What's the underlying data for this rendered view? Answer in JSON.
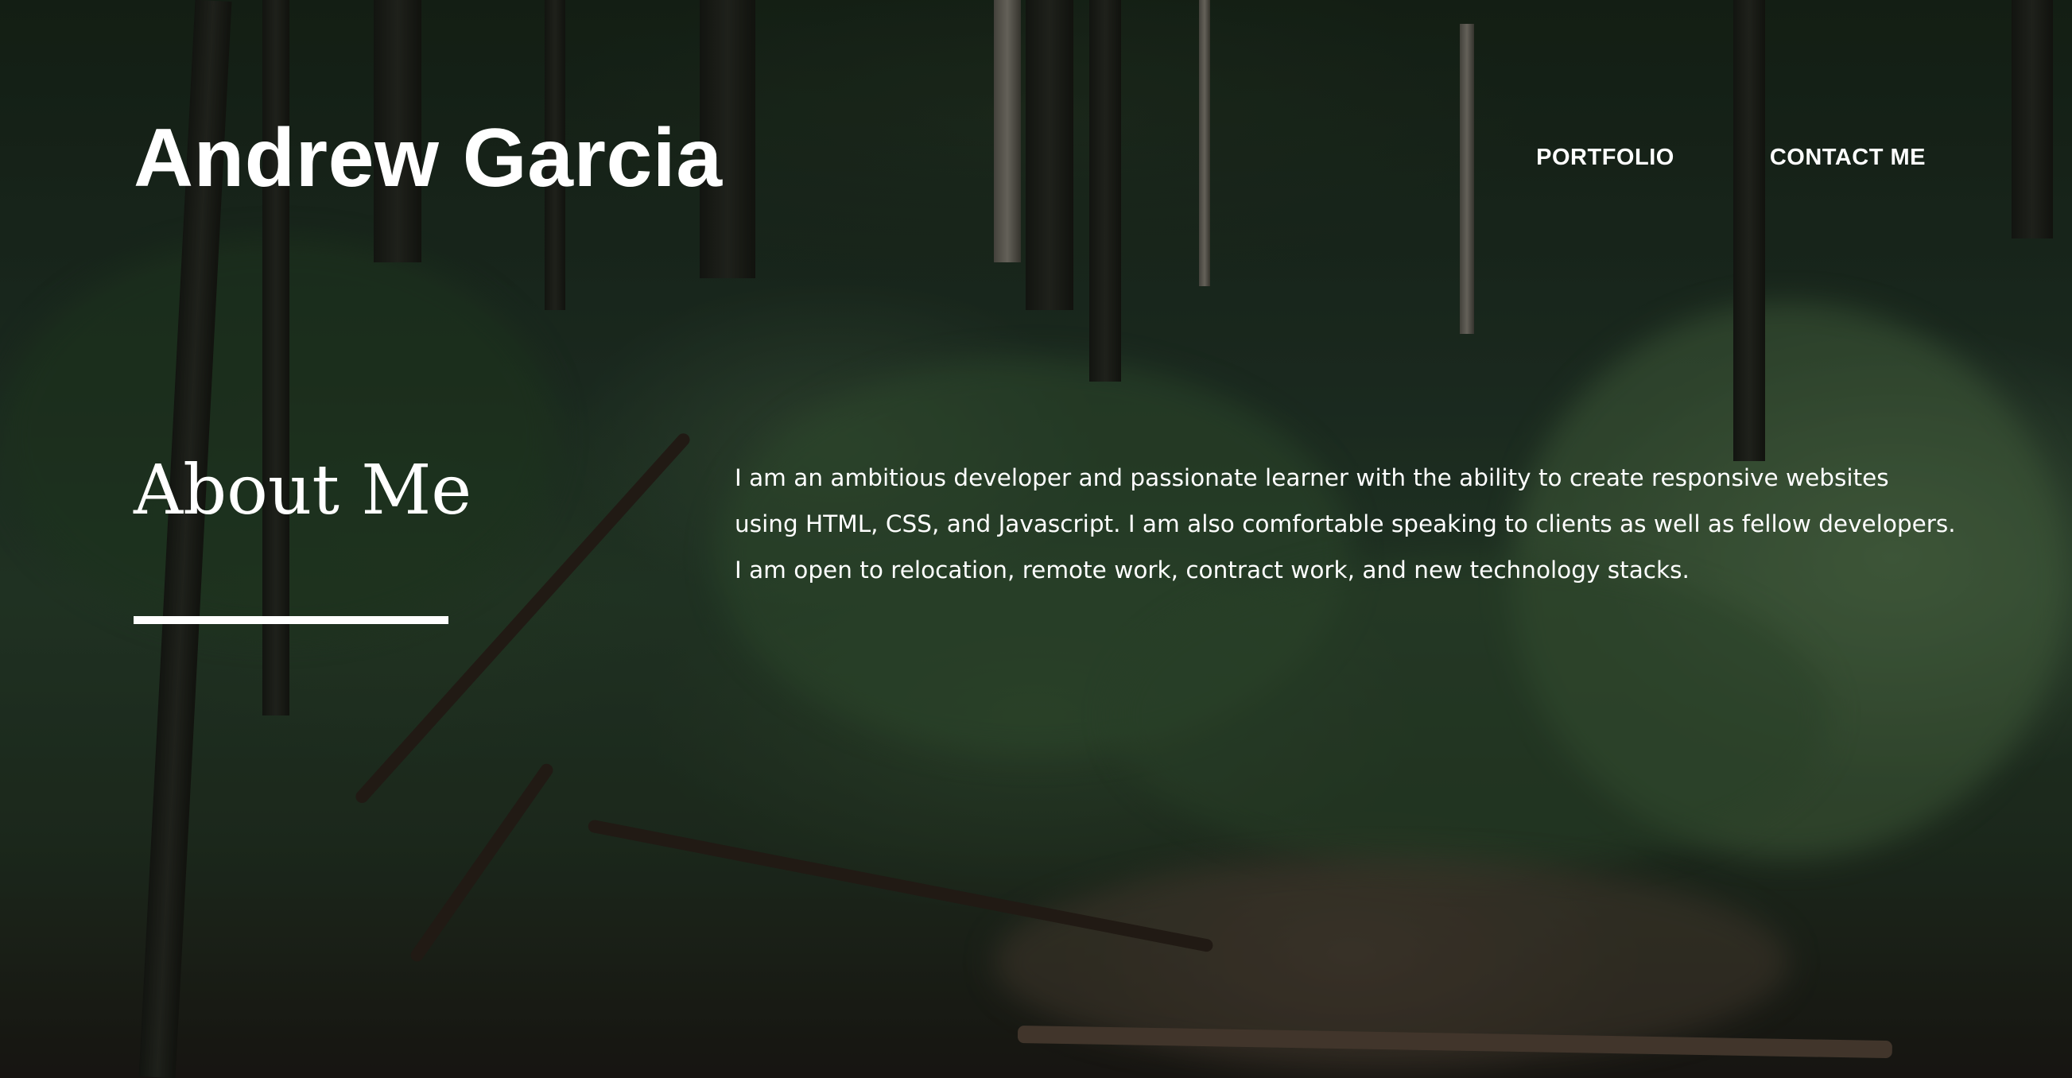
{
  "header": {
    "site_title": "Andrew Garcia",
    "nav": [
      {
        "label": "PORTFOLIO"
      },
      {
        "label": "CONTACT ME"
      }
    ]
  },
  "about": {
    "heading": "About Me",
    "body": "I am an ambitious developer and passionate learner with the ability to create responsive websites using HTML, CSS, and Javascript. I am also comfortable speaking to clients as well as fellow developers. I am open to relocation, remote work, contract work, and new technology stacks."
  }
}
